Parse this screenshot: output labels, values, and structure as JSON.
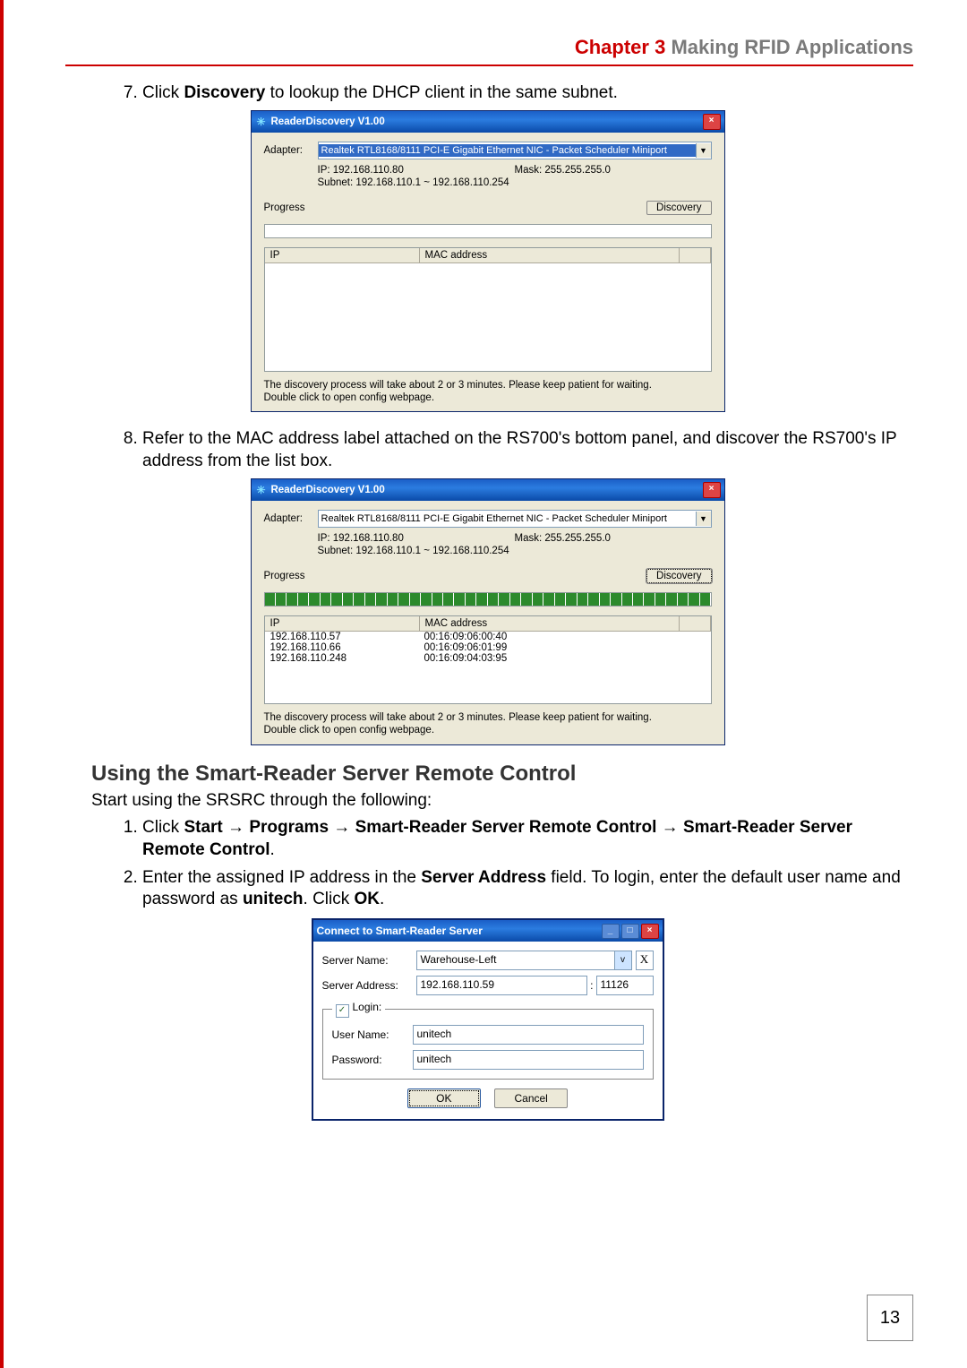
{
  "header": {
    "chapter_prefix": "Chapter 3",
    "chapter_title": "Making RFID Applications"
  },
  "step7": {
    "num": "7.",
    "pre": "Click ",
    "bold": "Discovery",
    "post": " to lookup the DHCP client in the same subnet."
  },
  "step8": {
    "num": "8.",
    "text": "Refer to the MAC address label attached on the RS700's bottom panel, and discover the RS700's IP address from the list box."
  },
  "discovery_win": {
    "title": "ReaderDiscovery V1.00",
    "adapter_label": "Adapter:",
    "adapter_value": "Realtek RTL8168/8111 PCI-E Gigabit Ethernet NIC - Packet Scheduler Miniport",
    "ip_label": "IP: 192.168.110.80",
    "mask_label": "Mask: 255.255.255.0",
    "subnet_label": "Subnet: 192.168.110.1 ~ 192.168.110.254",
    "progress_label": "Progress",
    "discovery_btn": "Discovery",
    "col_ip": "IP",
    "col_mac": "MAC address",
    "foot1": "The discovery process will take about 2 or 3 minutes. Please keep patient for waiting.",
    "foot2": "Double click to open config webpage.",
    "rows": [
      {
        "ip": "192.168.110.57",
        "mac": "00:16:09:06:00:40"
      },
      {
        "ip": "192.168.110.66",
        "mac": "00:16:09:06:01:99"
      },
      {
        "ip": "192.168.110.248",
        "mac": "00:16:09:04:03:95"
      }
    ]
  },
  "section_heading": "Using the Smart-Reader Server Remote Control",
  "srsrc_intro": "Start using the SRSRC through the following:",
  "srsrc_step1": {
    "num": "1.",
    "parts": {
      "p0": "Click ",
      "b1": "Start",
      "arr": " → ",
      "b2": "Programs",
      "b3": "Smart-Reader Server Remote Control",
      "b4": "Smart-Reader Server Remote Control",
      "end": "."
    }
  },
  "srsrc_step2": {
    "num": "2.",
    "p0": "Enter the assigned IP address in the ",
    "b1": "Server Address",
    "p1": " field. To login, enter the default user name and password as ",
    "b2": "unitech",
    "p2": ". Click ",
    "b3": "OK",
    "p3": "."
  },
  "connect_dlg": {
    "title": "Connect to Smart-Reader Server",
    "server_name_lbl": "Server Name:",
    "server_name_val": "Warehouse-Left",
    "server_addr_lbl": "Server Address:",
    "server_addr_val": "192.168.110.59",
    "port_sep": ":",
    "port_val": "11126",
    "login_legend": "Login:",
    "username_lbl": "User Name:",
    "username_val": "unitech",
    "password_lbl": "Password:",
    "password_val": "unitech",
    "ok_btn": "OK",
    "cancel_btn": "Cancel",
    "clear_btn": "X"
  },
  "page_number": "13"
}
